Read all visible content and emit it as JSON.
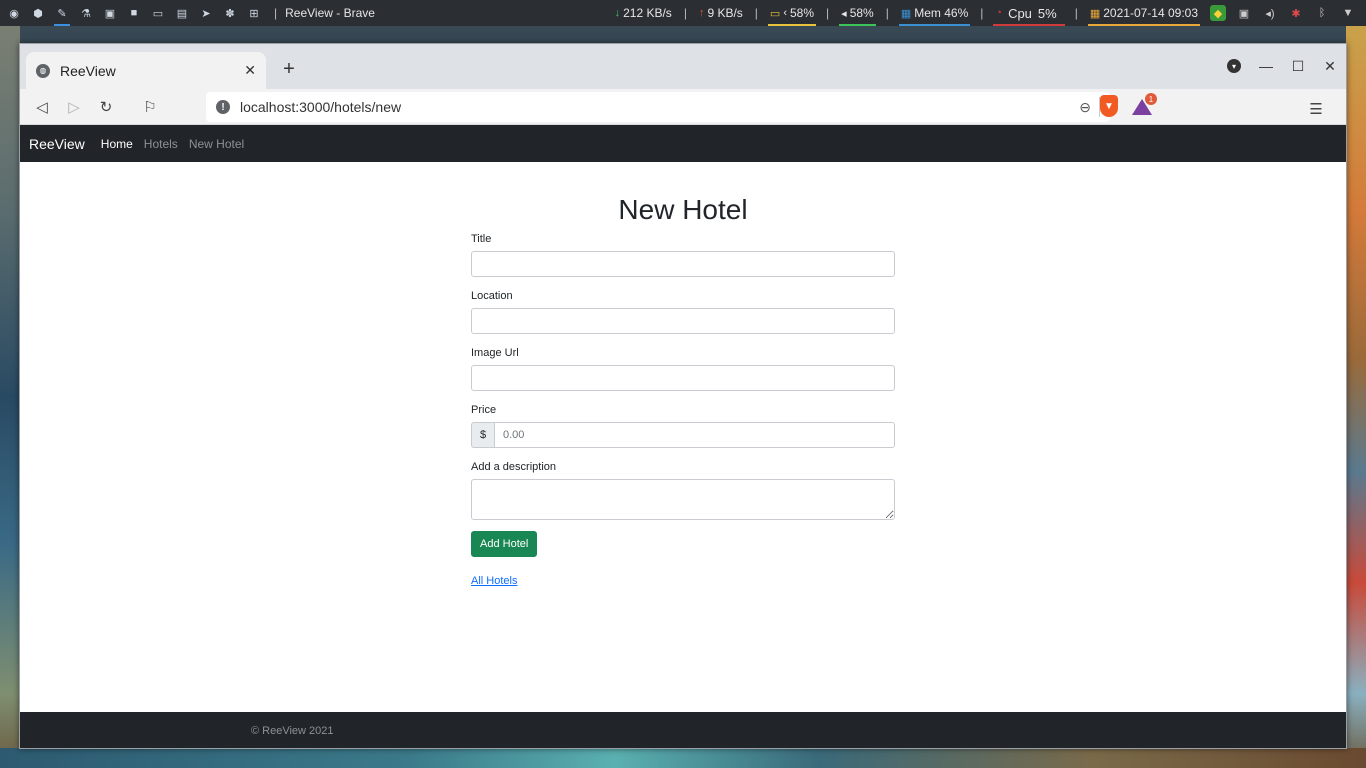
{
  "desktop_panel": {
    "window_title": "ReeView - Brave",
    "separator": "|",
    "stats": {
      "download": "212 KB/s",
      "upload": "9 KB/s",
      "battery": "58%",
      "volume": "58%",
      "memory": "Mem 46%",
      "cpu_label": "Cpu",
      "cpu_value": "5%",
      "datetime": "2021-07-14 09:03"
    },
    "colors": {
      "download": "#3cc35a",
      "upload": "#e05a3a",
      "battery": "#e8c23a",
      "volume": "#3cc35a",
      "memory": "#3a8fd0",
      "cpu": "#d03a3a",
      "calendar": "#e8a83a"
    }
  },
  "browser": {
    "tab": {
      "title": "ReeView"
    },
    "url": "localhost:3000/hotels/new",
    "rewards_badge": "1"
  },
  "navbar": {
    "brand": "ReeView",
    "links": [
      "Home",
      "Hotels",
      "New Hotel"
    ]
  },
  "form": {
    "heading": "New Hotel",
    "title_label": "Title",
    "location_label": "Location",
    "image_label": "Image Url",
    "price_label": "Price",
    "price_prefix": "$",
    "price_placeholder": "0.00",
    "description_label": "Add a description",
    "submit": "Add Hotel",
    "back_link": "All Hotels"
  },
  "footer": {
    "text": "© ReeView 2021"
  },
  "colors": {
    "navbar_bg": "#212529",
    "submit_bg": "#198754",
    "link": "#0d6efd"
  }
}
